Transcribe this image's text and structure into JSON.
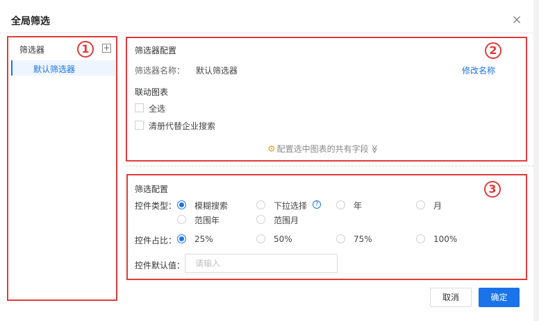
{
  "dialog": {
    "title": "全局筛选",
    "close_glyph": "×"
  },
  "left_panel": {
    "title": "筛选器",
    "add_glyph": "+",
    "items": [
      {
        "label": "默认筛选器"
      }
    ],
    "badge": "1"
  },
  "filter_config": {
    "title": "筛选器配置",
    "name_label": "筛选器名称：",
    "name_value": "默认筛选器",
    "rename_link": "修改名称",
    "linked_label": "联动图表",
    "checkboxes": [
      {
        "label": "全选",
        "checked": false
      },
      {
        "label": "清册代替企业搜索",
        "checked": false
      }
    ],
    "shared_fields_link": "配置选中图表的共有字段",
    "expand_glyph": "≫",
    "badge": "2"
  },
  "control_config": {
    "title": "筛选配置",
    "type_label": "控件类型：",
    "type_options": [
      {
        "label": "模糊搜索",
        "selected": true
      },
      {
        "label": "下拉选择",
        "selected": false
      },
      {
        "label": "年",
        "selected": false
      },
      {
        "label": "月",
        "selected": false
      },
      {
        "label": "范围年",
        "selected": false
      },
      {
        "label": "范围月",
        "selected": false
      }
    ],
    "help_glyph": "?",
    "ratio_label": "控件占比：",
    "ratio_options": [
      {
        "label": "25%",
        "selected": true
      },
      {
        "label": "50%",
        "selected": false
      },
      {
        "label": "75%",
        "selected": false
      },
      {
        "label": "100%",
        "selected": false
      }
    ],
    "default_label": "控件默认值：",
    "default_placeholder": "请输入",
    "default_value": "",
    "badge": "3"
  },
  "footer": {
    "cancel_label": "取消",
    "ok_label": "确定"
  },
  "colors": {
    "accent": "#1a73e8",
    "annotation": "#e03a3a",
    "gear": "#f0a020"
  }
}
